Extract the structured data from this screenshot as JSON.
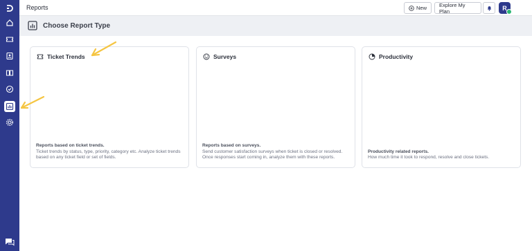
{
  "header": {
    "title": "Reports",
    "new_label": "New",
    "explore_label": "Explore My Plan",
    "avatar_initial": "R"
  },
  "subheader": {
    "title": "Choose Report Type"
  },
  "sidebar": {
    "items": [
      {
        "name": "home-icon"
      },
      {
        "name": "ticket-icon"
      },
      {
        "name": "contacts-icon"
      },
      {
        "name": "knowledge-base-icon"
      },
      {
        "name": "check-circle-icon"
      },
      {
        "name": "reports-icon",
        "active": true
      },
      {
        "name": "settings-icon"
      }
    ]
  },
  "cards": [
    {
      "title": "Ticket Trends",
      "icon": "ticket-icon",
      "lead": "Reports based on ticket trends.",
      "description": "Ticket trends by status, type, priority, category etc. Analyze ticket trends based on any ticket field or set of fields."
    },
    {
      "title": "Surveys",
      "icon": "smiley-icon",
      "lead": "Reports based on surveys.",
      "description": "Send customer satisfaction surveys when ticket is closed or resolved. Once responses start coming in, analyze them with these reports."
    },
    {
      "title": "Productivity",
      "icon": "pie-chart-icon",
      "lead": "Productivity related reports.",
      "description": "How much time it took to respond, resolve and close tickets."
    }
  ],
  "colors": {
    "sidebar": "#2e3a8c",
    "annotation_arrow": "#f5c542",
    "status_online": "#2bb673"
  }
}
